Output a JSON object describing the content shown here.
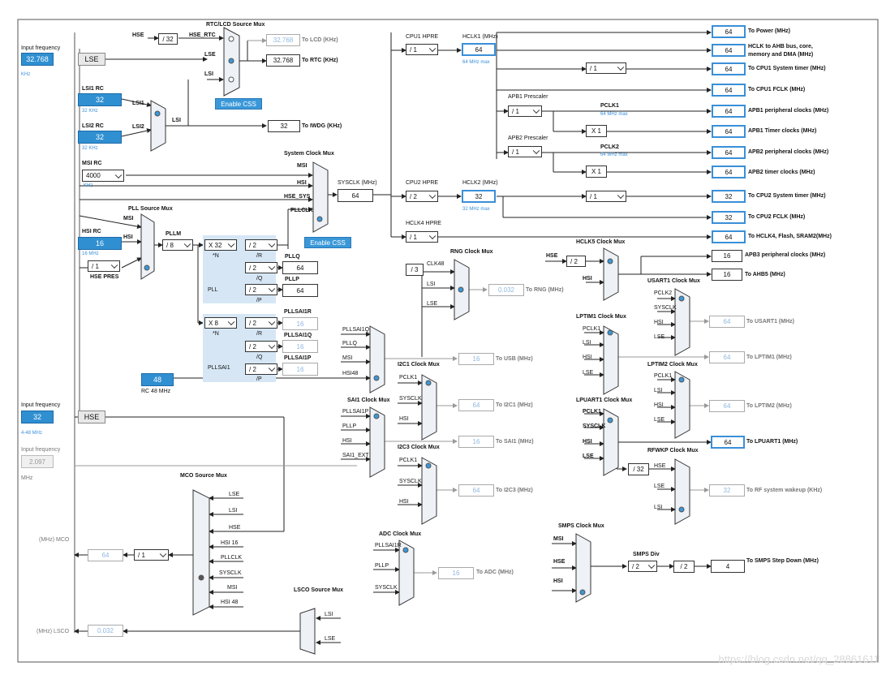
{
  "title_labels": {
    "rtc_lcd_mux": "RTC/LCD Source Mux",
    "system_clock_mux": "System Clock Mux",
    "pll_source_mux": "PLL Source Mux",
    "rng_clock_mux": "RNG Clock Mux",
    "hclk5_clock_mux": "HCLK5 Clock Mux",
    "usart1_clock_mux": "USART1 Clock Mux",
    "lptim1_clock_mux": "LPTIM1 Clock Mux",
    "lptim2_clock_mux": "LPTIM2 Clock Mux",
    "lpuart1_clock_mux": "LPUART1 Clock Mux",
    "rfwkp_clock_mux": "RFWKP Clock Mux",
    "i2c1_clock_mux": "I2C1 Clock Mux",
    "sai1_clock_mux": "SAI1 Clock Mux",
    "i2c3_clock_mux": "I2C3 Clock Mux",
    "mco_source_mux": "MCO Source Mux",
    "adc_clock_mux": "ADC Clock Mux",
    "lsco_source_mux": "LSCO Source Mux",
    "smps_clock_mux": "SMPS Clock Mux"
  },
  "inputs": {
    "lse_freq_label": "Input frequency",
    "lse_freq_value": "32.768",
    "lse_freq_unit": "KHz",
    "lse": "LSE",
    "lsi1_rc": "LSI1 RC",
    "lsi1_value": "32",
    "lsi1_unit": "32 KHz",
    "lsi2_rc": "LSI2 RC",
    "lsi2_value": "32",
    "lsi2_unit": "32 KHz",
    "msi_rc": "MSI RC",
    "msi_value": "4000",
    "msi_unit": "KHz",
    "hsi_rc": "HSI RC",
    "hsi_value": "16",
    "hsi_unit": "16 MHz",
    "hse_freq_label": "Input frequency",
    "hse_freq_value": "32",
    "hse_freq_unit": "4-48 MHz",
    "hse": "HSE",
    "in3_label": "Input frequency",
    "in3_value": "2.097",
    "in3_unit": "MHz",
    "rc48_value": "48",
    "rc48_unit": "RC 48 MHz"
  },
  "rtc": {
    "hse_label": "HSE",
    "hse_div": "/ 32",
    "hse_rtc": "HSE_RTC",
    "lse": "LSE",
    "lsi": "LSI",
    "lcd_value": "32.768",
    "lcd_label": "To LCD (KHz)",
    "rtc_value": "32.768",
    "rtc_label": "To RTC (KHz)",
    "enable_css": "Enable CSS",
    "lsi1": "LSI1",
    "lsi2": "LSI2",
    "iwdg_value": "32",
    "iwdg_label": "To IWDG (KHz)"
  },
  "sysclk": {
    "msi": "MSI",
    "hsi": "HSI",
    "hse_sys": "HSE_SYS",
    "pllclk": "PLLCLK",
    "label": "SYSCLK (MHz)",
    "value": "64",
    "enable_css": "Enable CSS"
  },
  "pll": {
    "msi": "MSI",
    "hsi": "HSI",
    "pllm_label": "PLLM",
    "pllm": "/ 8",
    "hse_pres": "HSE PRES",
    "hse_pres_value": "/ 1",
    "n": "X 32",
    "n_label": "*N",
    "r": "/ 2",
    "r_label": "/R",
    "q": "/ 2",
    "q_label": "/Q",
    "p": "/ 2",
    "p_label": "/P",
    "pll_label": "PLL",
    "pllq_label": "PLLQ",
    "pllq_value": "64",
    "pllp_label": "PLLP",
    "pllp_value": "64",
    "sai_n": "X 8",
    "sai_n_label": "*N",
    "sai_r": "/ 2",
    "sai_r_label": "/R",
    "sai_q": "/ 2",
    "sai_q_label": "/Q",
    "sai_p": "/ 2",
    "sai_p_label": "/P",
    "pllsai1_label": "PLLSAI1",
    "pllsai1r_label": "PLLSAI1R",
    "pllsai1r_value": "16",
    "pllsai1q_label": "PLLSAI1Q",
    "pllsai1q_value": "16",
    "pllsai1p_label": "PLLSAI1P",
    "pllsai1p_value": "16"
  },
  "hclk": {
    "cpu1_hpre_label": "CPU1 HPRE",
    "cpu1_hpre": "/ 1",
    "hclk1_label": "HCLK1 (MHz)",
    "hclk1_value": "64",
    "hclk1_max": "64 MHz max",
    "cpu2_hpre_label": "CPU2 HPRE",
    "cpu2_hpre": "/ 2",
    "hclk2_label": "HCLK2 (MHz)",
    "hclk2_value": "32",
    "hclk2_max": "32 MHz max",
    "hclk4_hpre_label": "HCLK4 HPRE",
    "hclk4_hpre": "/ 1",
    "cpu1_systimer_div": "/ 1",
    "cpu2_systimer_div": "/ 1",
    "apb1_prescaler_label": "APB1 Prescaler",
    "apb1_prescaler": "/ 1",
    "pclk1_label": "PCLK1",
    "pclk1_max": "64 MHz max",
    "apb1_timer_mult": "X 1",
    "apb2_prescaler_label": "APB2 Prescaler",
    "apb2_prescaler": "/ 1",
    "pclk2_label": "PCLK2",
    "pclk2_max": "64 MHz max",
    "apb2_timer_mult": "X 1"
  },
  "outputs": [
    {
      "value": "64",
      "label": "To Power (MHz)"
    },
    {
      "value": "64",
      "label": "HCLK to AHB bus, core,"
    },
    {
      "value": "64",
      "label": "To CPU1 System timer (MHz)"
    },
    {
      "value": "64",
      "label": "To CPU1 FCLK (MHz)"
    },
    {
      "value": "64",
      "label": "APB1 peripheral clocks (MHz)"
    },
    {
      "value": "64",
      "label": "APB1 Timer clocks (MHz)"
    },
    {
      "value": "64",
      "label": "APB2 peripheral clocks (MHz)"
    },
    {
      "value": "64",
      "label": "APB2 timer clocks (MHz)"
    },
    {
      "value": "32",
      "label": "To CPU2 System timer (MHz)"
    },
    {
      "value": "32",
      "label": "To CPU2 FCLK (MHz)"
    },
    {
      "value": "64",
      "label": "To HCLK4, Flash, SRAM2(MHz)"
    }
  ],
  "outputs_line2": "memory and DMA (MHz)",
  "hclk5": {
    "hse": "HSE",
    "div": "/ 2",
    "hsi": "HSI",
    "apb3_value": "16",
    "apb3_label": "APB3 peripheral clocks (MHz)",
    "ahb5_value": "16",
    "ahb5_label": "To AHB5 (MHz)"
  },
  "rng": {
    "div": "/ 3",
    "clk48": "CLK48",
    "lsi": "LSI",
    "lse": "LSE",
    "value": "0.032",
    "label": "To RNG (MHz)"
  },
  "usart1": {
    "pclk2": "PCLK2",
    "sysclk": "SYSCLK",
    "hsi": "HSI",
    "lse": "LSE",
    "value": "64",
    "label": "To USART1 (MHz)"
  },
  "lptim1": {
    "pclk1": "PCLK1",
    "lsi": "LSI",
    "hsi": "HSI",
    "lse": "LSE",
    "value": "64",
    "label": "To LPTIM1 (MHz)"
  },
  "lptim2": {
    "pclk1": "PCLK1",
    "lsi": "LSI",
    "hsi": "HSI",
    "lse": "LSE",
    "value": "64",
    "label": "To LPTIM2 (MHz)"
  },
  "lpuart1": {
    "pclk1": "PCLK1",
    "sysclk": "SYSCLK",
    "hsi": "HSI",
    "lse": "LSE",
    "value": "64",
    "label": "To LPUART1 (MHz)"
  },
  "rfwkp": {
    "div": "/ 32",
    "hse": "HSE",
    "lse": "LSE",
    "lsi": "LSI",
    "value": "32",
    "label": "To RF system wakeup (KHz)"
  },
  "usb": {
    "pllsai1q": "PLLSAI1Q",
    "pllq": "PLLQ",
    "msi": "MSI",
    "hsi48": "HSI48",
    "value": "16",
    "label": "To USB (MHz)"
  },
  "i2c1": {
    "pclk1": "PCLK1",
    "sysclk": "SYSCLK",
    "hsi": "HSI",
    "value": "64",
    "label": "To I2C1 (MHz)"
  },
  "sai1": {
    "pllsai1p": "PLLSAI1P",
    "pllp": "PLLP",
    "hsi": "HSI",
    "sai1_ext": "SAI1_EXT",
    "value": "16",
    "label": "To SAI1 (MHz)"
  },
  "i2c3": {
    "pclk1": "PCLK1",
    "sysclk": "SYSCLK",
    "hsi": "HSI",
    "value": "64",
    "label": "To I2C3 (MHz)"
  },
  "mco": {
    "lse": "LSE",
    "lsi": "LSI",
    "hse": "HSE",
    "hsi16": "HSI 16",
    "pllclk": "PLLCLK",
    "sysclk": "SYSCLK",
    "msi": "MSI",
    "hsi48": "HSI 48",
    "out_label": "(MHz) MCO",
    "value": "64",
    "div": "/ 1"
  },
  "adc": {
    "pllsai1r": "PLLSAI1R",
    "pllp": "PLLP",
    "sysclk": "SYSCLK",
    "value": "16",
    "label": "To ADC (MHz)"
  },
  "lsco": {
    "lsi": "LSI",
    "lse": "LSE",
    "out_label": "(MHz) LSCO",
    "value": "0.032"
  },
  "smps": {
    "msi": "MSI",
    "hse": "HSE",
    "hsi": "HSI",
    "div_label": "SMPS Div",
    "div": "/ 2",
    "div2": "/ 2",
    "value": "4",
    "label": "To SMPS Step Down (MHz)"
  },
  "watermark": "https://blog.csdn.net/qq_28861611"
}
